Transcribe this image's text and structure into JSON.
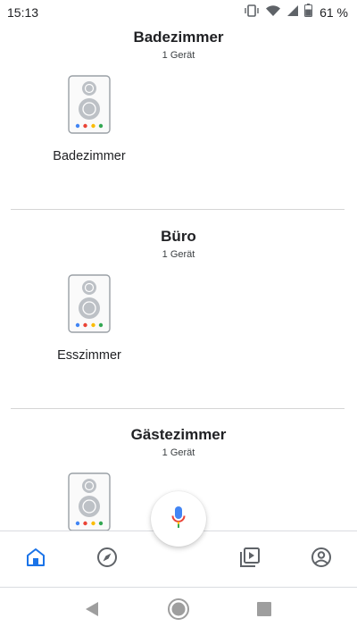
{
  "status_bar": {
    "time": "15:13",
    "battery_percent": "61 %",
    "icons": [
      "vibrate-icon",
      "wifi-icon",
      "cell-signal-icon",
      "battery-icon"
    ]
  },
  "rooms": [
    {
      "title": "Badezimmer",
      "device_count": "1 Gerät",
      "devices": [
        {
          "label": "Badezimmer",
          "icon": "speaker-icon"
        }
      ]
    },
    {
      "title": "Büro",
      "device_count": "1 Gerät",
      "devices": [
        {
          "label": "Esszimmer",
          "icon": "speaker-icon"
        }
      ]
    },
    {
      "title": "Gästezimmer",
      "device_count": "1 Gerät",
      "devices": [
        {
          "label": "",
          "icon": "speaker-icon"
        }
      ]
    }
  ],
  "assistant": {
    "icon": "microphone-icon"
  },
  "bottom_nav": {
    "items": [
      {
        "icon": "home-icon",
        "active": true
      },
      {
        "icon": "explore-icon",
        "active": false
      },
      {
        "icon": "media-icon",
        "active": false
      },
      {
        "icon": "account-icon",
        "active": false
      }
    ]
  },
  "colors": {
    "accent": "#1a73e8",
    "icon_gray": "#5f6368",
    "google_blue": "#4285f4",
    "google_red": "#ea4335",
    "google_yellow": "#fbbc05",
    "google_green": "#34a853"
  }
}
